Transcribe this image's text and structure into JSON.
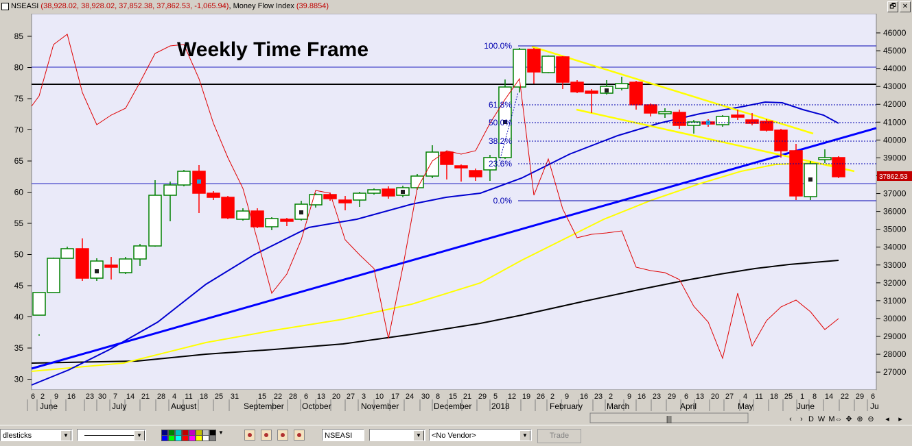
{
  "window": {
    "symbol_line": "NSEASI",
    "ohlc_values": "(38,928.02, 38,928.02, 37,852.38, 37,862.53, -1,065.94)",
    "indicator_label": "Money Flow Index",
    "indicator_value": "(39.8854)",
    "restore_label": "🗗",
    "close_label": "✕"
  },
  "chart": {
    "annotation": "Weekly Time Frame",
    "last_price_label": "37862.53",
    "fib_labels": [
      "100.0%",
      "61.8%",
      "50.0%",
      "38.2%",
      "23.6%",
      "0.0%"
    ],
    "left_axis_ticks": [
      "85",
      "80",
      "75",
      "70",
      "65",
      "60",
      "55",
      "50",
      "45",
      "40",
      "35",
      "30"
    ],
    "right_axis_ticks": [
      "46000",
      "45000",
      "44000",
      "43000",
      "42000",
      "41000",
      "40000",
      "39000",
      "38000",
      "37000",
      "36000",
      "35000",
      "34000",
      "33000",
      "32000",
      "31000",
      "30000",
      "29000",
      "28000",
      "27000"
    ],
    "date_ticks": [
      "6",
      "2",
      "9",
      "16",
      "23",
      "30",
      "7",
      "14",
      "21",
      "28",
      "4",
      "11",
      "18",
      "25",
      "31",
      "15",
      "22",
      "28",
      "6",
      "13",
      "20",
      "27",
      "3",
      "10",
      "17",
      "24",
      "30",
      "8",
      "15",
      "21",
      "29",
      "5",
      "12",
      "19",
      "26",
      "2",
      "9",
      "16",
      "23",
      "2",
      "9",
      "16",
      "23",
      "29",
      "6",
      "13",
      "20",
      "27",
      "4",
      "11",
      "18",
      "25",
      "1",
      "8",
      "14",
      "22",
      "29",
      "6"
    ],
    "month_labels": [
      "June",
      "July",
      "August",
      "September",
      "October",
      "November",
      "December",
      "2018",
      "February",
      "March",
      "April",
      "May",
      "June",
      "Ju"
    ],
    "nav_labels": [
      "|||",
      "‹",
      "›",
      "D",
      "W",
      "M",
      "⇔",
      "✥",
      "⊕",
      "⊖",
      "◂",
      "▸"
    ]
  },
  "statusbar": {
    "chart_type": "dlesticks",
    "symbol": "NSEASI",
    "vendor": "<No Vendor>",
    "trade_label": "Trade"
  },
  "colors": {
    "chart_bg": "#eaeaf9",
    "up_candle": "#008000",
    "down_candle": "#ff0000",
    "mfi_line": "#e00000",
    "ma_short": "#0000d0",
    "ma_mid": "#ffff00",
    "ma_long": "#000000",
    "trend_line": "#0000ff",
    "fib_line": "#0000b0"
  }
}
